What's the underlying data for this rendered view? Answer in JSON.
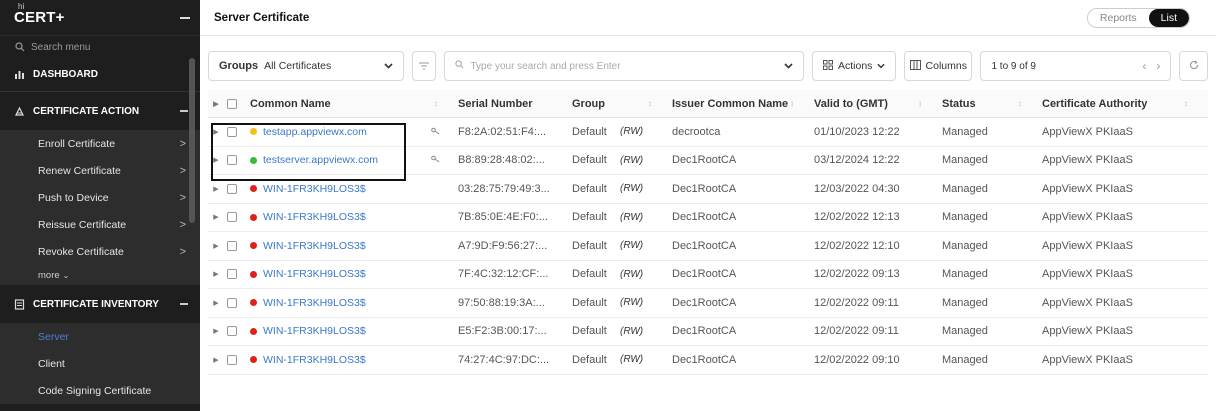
{
  "app": {
    "brand": "CERT+",
    "brand_sup": "hi"
  },
  "sidebar": {
    "search_placeholder": "Search menu",
    "dashboard_label": "DASHBOARD",
    "sections": [
      {
        "label": "CERTIFICATE ACTION",
        "items": [
          {
            "label": "Enroll Certificate",
            "chevron": ">"
          },
          {
            "label": "Renew Certificate",
            "chevron": ">"
          },
          {
            "label": "Push to Device",
            "chevron": ">"
          },
          {
            "label": "Reissue Certificate",
            "chevron": ">"
          },
          {
            "label": "Revoke Certificate",
            "chevron": ">"
          }
        ],
        "more_label": "more"
      },
      {
        "label": "CERTIFICATE INVENTORY",
        "items": [
          {
            "label": "Server",
            "active": true
          },
          {
            "label": "Client"
          },
          {
            "label": "Code Signing Certificate"
          }
        ]
      }
    ],
    "active_color": "#4a7fd4"
  },
  "header": {
    "title": "Server Certificate",
    "view_toggle": {
      "off_label": "Reports",
      "on_label": "List"
    }
  },
  "toolbar": {
    "groups_label": "Groups",
    "groups_value": "All Certificates",
    "search_placeholder": "Type your search and press Enter",
    "actions_label": "Actions",
    "columns_label": "Columns",
    "pager_label": "1 to 9 of 9"
  },
  "table": {
    "columns": [
      "Common Name",
      "Serial Number",
      "Group",
      "Issuer Common Name",
      "Valid to (GMT)",
      "Status",
      "Certificate Authority"
    ],
    "rows": [
      {
        "status_color": "#f2c21b",
        "name": "testapp.appviewx.com",
        "key": true,
        "serial": "F8:2A:02:51:F4:...",
        "group": "Default",
        "rw": "(RW)",
        "issuer": "decrootca",
        "valid": "01/10/2023 12:22",
        "status": "Managed",
        "ca": "AppViewX PKIaaS"
      },
      {
        "status_color": "#3db83a",
        "name": "testserver.appviewx.com",
        "key": true,
        "serial": "B8:89:28:48:02:...",
        "group": "Default",
        "rw": "(RW)",
        "issuer": "Dec1RootCA",
        "valid": "03/12/2024 12:22",
        "status": "Managed",
        "ca": "AppViewX PKIaaS"
      },
      {
        "status_color": "#e0201b",
        "name": "WIN-1FR3KH9LOS3$",
        "key": false,
        "serial": "03:28:75:79:49:3...",
        "group": "Default",
        "rw": "(RW)",
        "issuer": "Dec1RootCA",
        "valid": "12/03/2022 04:30",
        "status": "Managed",
        "ca": "AppViewX PKIaaS"
      },
      {
        "status_color": "#e0201b",
        "name": "WIN-1FR3KH9LOS3$",
        "key": false,
        "serial": "7B:85:0E:4E:F0:...",
        "group": "Default",
        "rw": "(RW)",
        "issuer": "Dec1RootCA",
        "valid": "12/02/2022 12:13",
        "status": "Managed",
        "ca": "AppViewX PKIaaS"
      },
      {
        "status_color": "#e0201b",
        "name": "WIN-1FR3KH9LOS3$",
        "key": false,
        "serial": "A7:9D:F9:56:27:...",
        "group": "Default",
        "rw": "(RW)",
        "issuer": "Dec1RootCA",
        "valid": "12/02/2022 12:10",
        "status": "Managed",
        "ca": "AppViewX PKIaaS"
      },
      {
        "status_color": "#e0201b",
        "name": "WIN-1FR3KH9LOS3$",
        "key": false,
        "serial": "7F:4C:32:12:CF:...",
        "group": "Default",
        "rw": "(RW)",
        "issuer": "Dec1RootCA",
        "valid": "12/02/2022 09:13",
        "status": "Managed",
        "ca": "AppViewX PKIaaS"
      },
      {
        "status_color": "#e0201b",
        "name": "WIN-1FR3KH9LOS3$",
        "key": false,
        "serial": "97:50:88:19:3A:...",
        "group": "Default",
        "rw": "(RW)",
        "issuer": "Dec1RootCA",
        "valid": "12/02/2022 09:11",
        "status": "Managed",
        "ca": "AppViewX PKIaaS"
      },
      {
        "status_color": "#e0201b",
        "name": "WIN-1FR3KH9LOS3$",
        "key": false,
        "serial": "E5:F2:3B:00:17:...",
        "group": "Default",
        "rw": "(RW)",
        "issuer": "Dec1RootCA",
        "valid": "12/02/2022 09:11",
        "status": "Managed",
        "ca": "AppViewX PKIaaS"
      },
      {
        "status_color": "#e0201b",
        "name": "WIN-1FR3KH9LOS3$",
        "key": false,
        "serial": "74:27:4C:97:DC:...",
        "group": "Default",
        "rw": "(RW)",
        "issuer": "Dec1RootCA",
        "valid": "12/02/2022 09:10",
        "status": "Managed",
        "ca": "AppViewX PKIaaS"
      }
    ]
  }
}
